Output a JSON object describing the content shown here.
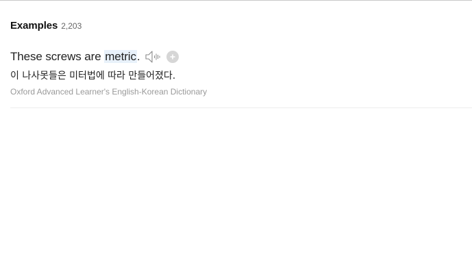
{
  "examples": {
    "title": "Examples",
    "count": "2,203",
    "items": [
      {
        "sentence_before": "These screws are ",
        "sentence_highlight": "metric",
        "sentence_after": ".",
        "translation": "이 나사못들은 미터법에 따라 만들어졌다.",
        "source": "Oxford Advanced Learner's English-Korean Dictionary",
        "icons": {
          "speaker": "speaker-icon",
          "add": "plus-icon"
        }
      }
    ]
  },
  "colors": {
    "highlight": "#e8f1fa",
    "source_text": "#999999",
    "icon_gray": "#d6d6d6"
  }
}
